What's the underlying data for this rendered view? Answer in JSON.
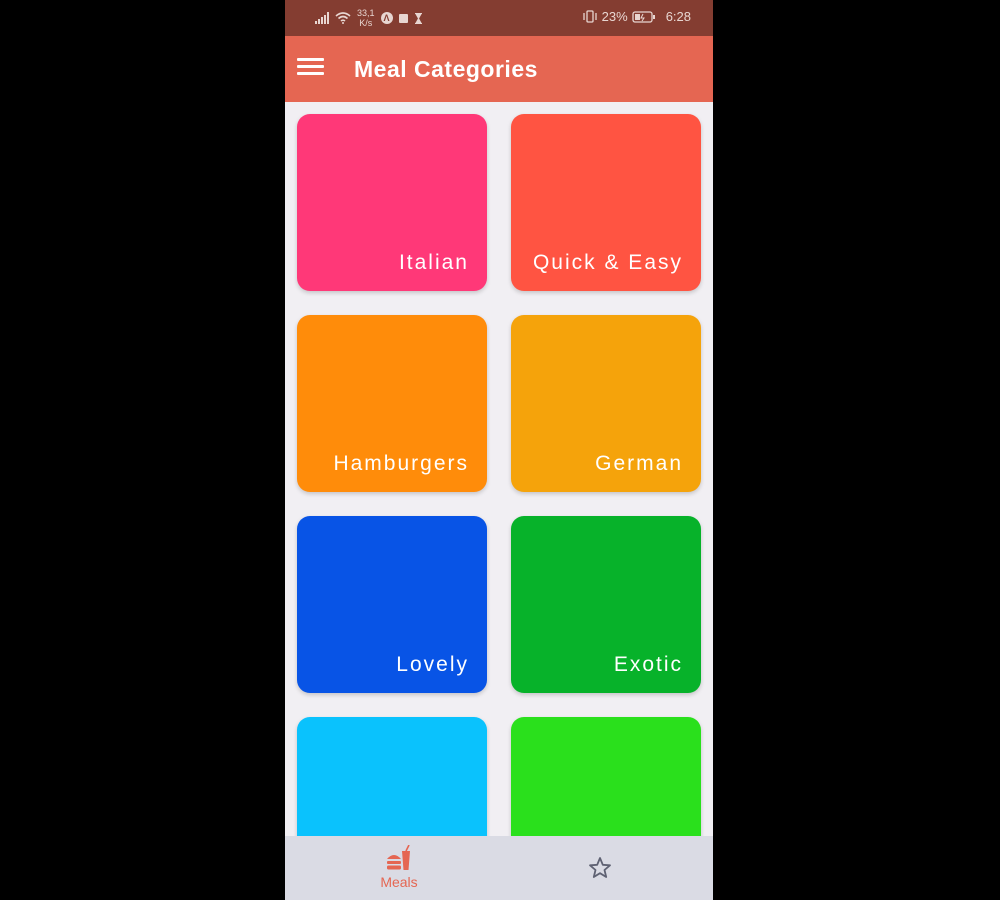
{
  "status_bar": {
    "net_speed_value": "33,1",
    "net_speed_unit": "K/s",
    "battery_percent": "23%",
    "time": "6:28",
    "icons": [
      "signal-icon",
      "wifi-icon",
      "a-circle-icon",
      "square-icon",
      "hourglass-icon",
      "vibrate-icon",
      "battery-icon"
    ]
  },
  "app_bar": {
    "title": "Meal Categories",
    "menu_icon": "hamburger-menu-icon",
    "color": "#e56652"
  },
  "categories": [
    {
      "label": "Italian",
      "color": "#ff3878"
    },
    {
      "label": "Quick & Easy",
      "color": "#ff5442"
    },
    {
      "label": "Hamburgers",
      "color": "#ff8c0a"
    },
    {
      "label": "German",
      "color": "#f5a30b"
    },
    {
      "label": "Lovely",
      "color": "#0854e6"
    },
    {
      "label": "Exotic",
      "color": "#07b22a"
    },
    {
      "label": "",
      "color": "#0ac2fd"
    },
    {
      "label": "",
      "color": "#2ae01c"
    }
  ],
  "bottom_nav": {
    "items": [
      {
        "label": "Meals",
        "icon": "meals-icon",
        "active": true
      },
      {
        "label": "",
        "icon": "star-icon",
        "active": false
      }
    ],
    "active_color": "#e56652"
  }
}
